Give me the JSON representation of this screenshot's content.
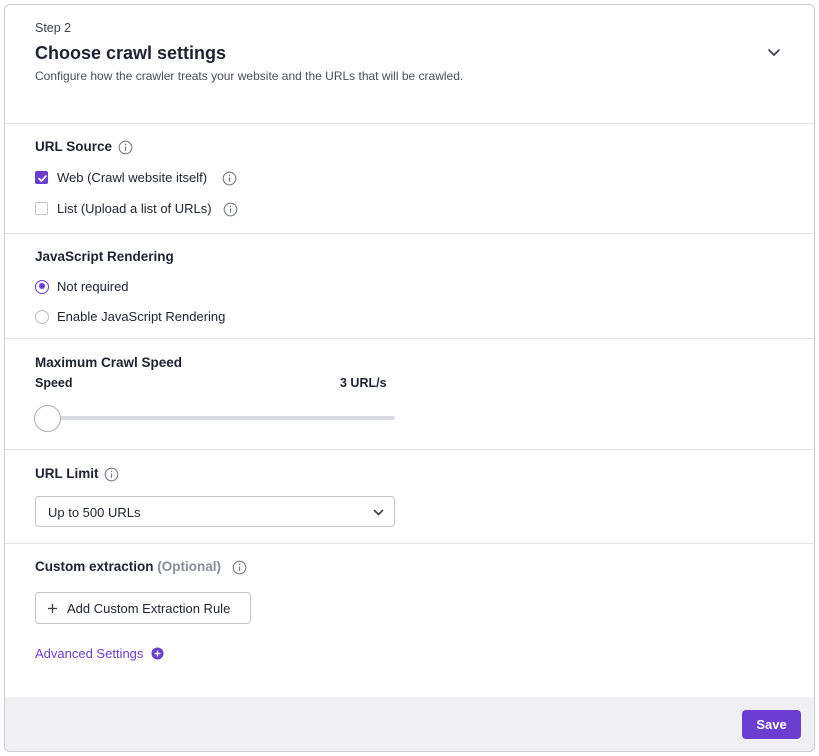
{
  "header": {
    "step": "Step 2",
    "title": "Choose crawl settings",
    "description": "Configure how the crawler treats your website and the URLs that will be crawled.",
    "collapse_icon": "chevron-down-icon"
  },
  "url_source": {
    "title": "URL Source",
    "options": [
      {
        "label": "Web (Crawl website itself)",
        "checked": true
      },
      {
        "label": "List (Upload a list of URLs)",
        "checked": false
      }
    ]
  },
  "js_rendering": {
    "title": "JavaScript Rendering",
    "options": [
      {
        "label": "Not required",
        "selected": true
      },
      {
        "label": "Enable JavaScript Rendering",
        "selected": false
      }
    ]
  },
  "crawl_speed": {
    "title": "Maximum Crawl Speed",
    "label": "Speed",
    "value_text": "3 URL/s",
    "slider_fraction": 0
  },
  "url_limit": {
    "title": "URL Limit",
    "selected": "Up to 500 URLs"
  },
  "custom_extraction": {
    "title": "Custom extraction",
    "optional": "(Optional)",
    "add_button": "Add Custom Extraction Rule",
    "advanced": "Advanced Settings"
  },
  "footer": {
    "save": "Save"
  },
  "colors": {
    "accent": "#6c3dd1",
    "footer_bg": "#f0f0f3",
    "divider": "#e3e4e8"
  }
}
